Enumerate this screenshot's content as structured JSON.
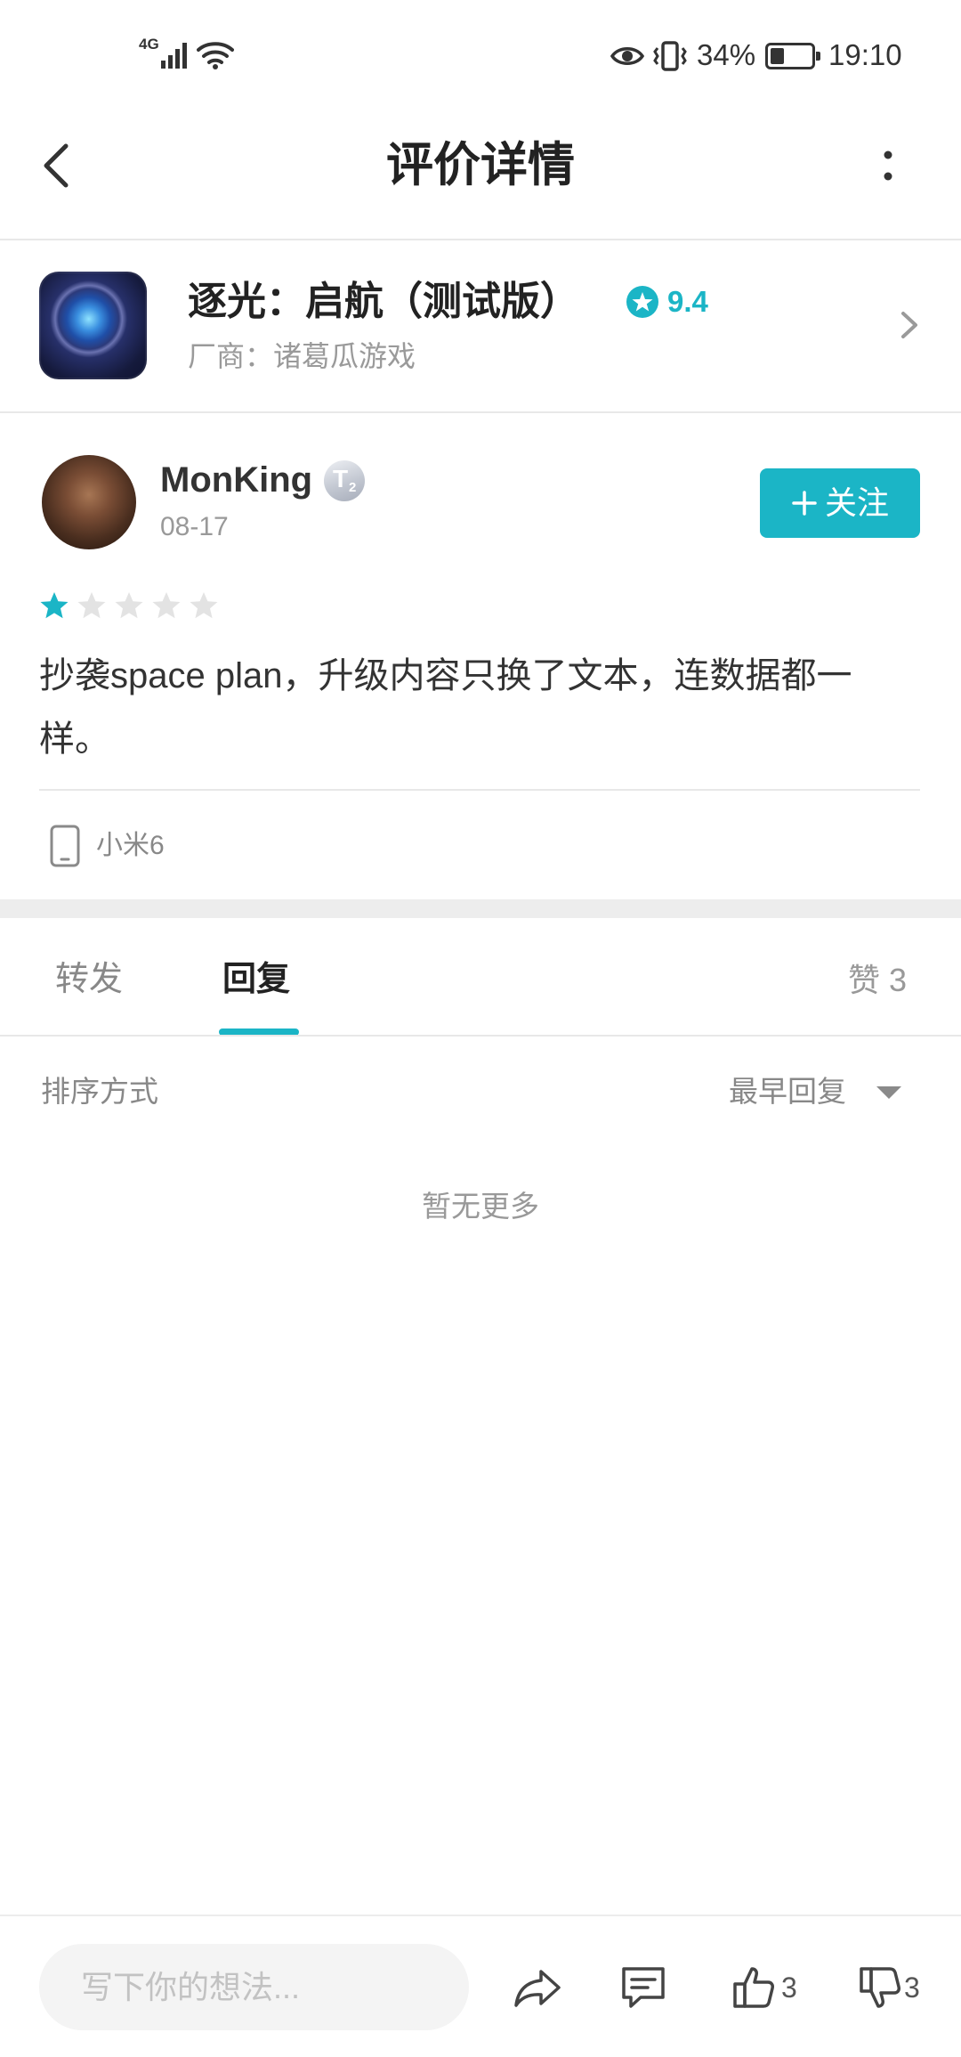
{
  "colors": {
    "accent": "#1bb5c6",
    "text_primary": "#222222",
    "text_secondary": "#999999",
    "divider": "#e8e8e8"
  },
  "status_bar": {
    "network_type": "4G",
    "battery_percent": "34%",
    "battery_level": 0.34,
    "time": "19:10",
    "icons": [
      "signal-icon",
      "wifi-icon",
      "eye-icon",
      "vibrate-icon",
      "battery-icon"
    ]
  },
  "header": {
    "title": "评价详情",
    "back_icon": "back-chevron-icon",
    "more_icon": "more-vertical-icon"
  },
  "app": {
    "name": "逐光：启航（测试版）",
    "rating": "9.4",
    "vendor": "厂商：诸葛瓜游戏"
  },
  "review": {
    "user_name": "MonKing",
    "badge": {
      "letter": "T",
      "level": "2"
    },
    "date": "08-17",
    "follow_label": "关注",
    "stars_filled": 1,
    "stars_total": 5,
    "text": "抄袭space plan，升级内容只换了文本，连数据都一样。",
    "device": "小米6"
  },
  "tabs": [
    {
      "label": "转发",
      "active": false
    },
    {
      "label": "回复",
      "active": true
    }
  ],
  "likes": {
    "label": "赞",
    "count": "3"
  },
  "sort": {
    "label": "排序方式",
    "value": "最早回复"
  },
  "empty_message": "暂无更多",
  "composer": {
    "placeholder": "写下你的想法...",
    "like_count": "3",
    "dislike_count": "3"
  }
}
